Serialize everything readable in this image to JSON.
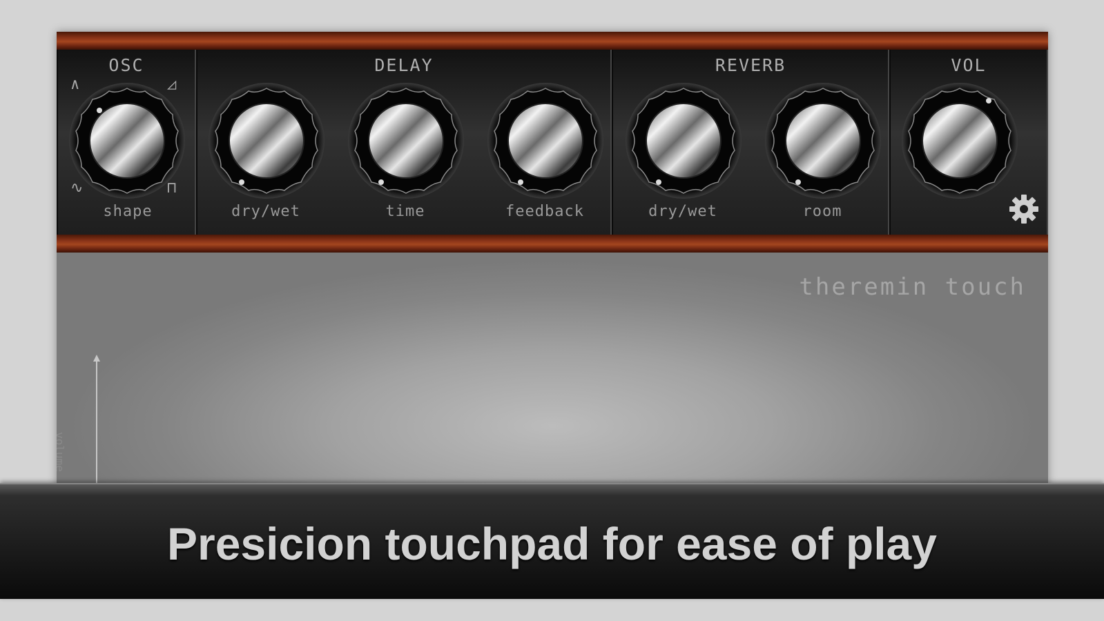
{
  "app": {
    "name": "theremin touch"
  },
  "sections": [
    {
      "title": "OSC",
      "knobs": [
        {
          "label": "shape"
        }
      ]
    },
    {
      "title": "DELAY",
      "knobs": [
        {
          "label": "dry/wet"
        },
        {
          "label": "time"
        },
        {
          "label": "feedback"
        }
      ]
    },
    {
      "title": "REVERB",
      "knobs": [
        {
          "label": "dry/wet"
        },
        {
          "label": "room"
        }
      ]
    },
    {
      "title": "VOL",
      "knobs": [
        {
          "label": ""
        }
      ]
    }
  ],
  "osc_shape_icons": {
    "top_left": "∧",
    "top_right": "◿",
    "bottom_left": "∿",
    "bottom_right": "⊓"
  },
  "touchpad": {
    "title": "theremin touch",
    "axis_label": "volume"
  },
  "banner": {
    "text": "Presicion touchpad for ease of play"
  },
  "icons": {
    "settings": "gear-icon"
  },
  "colors": {
    "wood": "#8a3418",
    "panel": "#1e1e1e",
    "label": "#9a9a9a",
    "pad_center": "#bcbcbc"
  }
}
